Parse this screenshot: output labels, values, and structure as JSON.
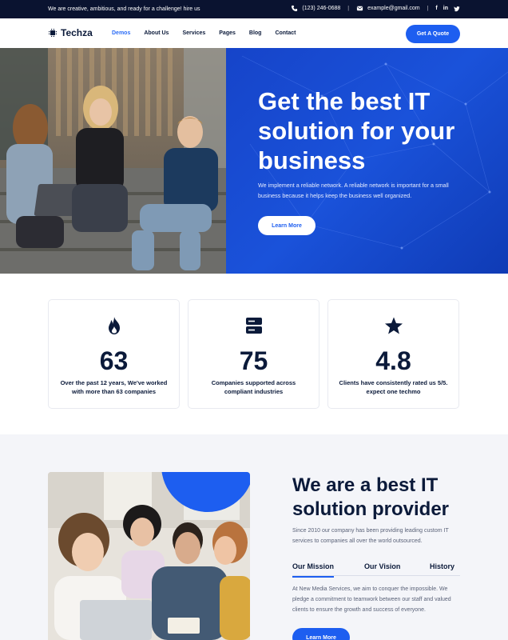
{
  "topbar": {
    "tagline": "We are creative, ambitious, and ready for a challenge! hire us",
    "phone": "(123) 246-0688",
    "email": "example@gmail.com",
    "social": [
      "f",
      "in",
      "t"
    ]
  },
  "nav": {
    "logo": "Techza",
    "items": [
      {
        "label": "Demos",
        "active": true
      },
      {
        "label": "About Us",
        "active": false
      },
      {
        "label": "Services",
        "active": false
      },
      {
        "label": "Pages",
        "active": false
      },
      {
        "label": "Blog",
        "active": false
      },
      {
        "label": "Contact",
        "active": false
      }
    ],
    "cta": "Get A Quote"
  },
  "hero": {
    "title": "Get the best IT solution for your business",
    "description": "We implement a reliable network. A reliable network is important for a small business because it helps keep the business well organized.",
    "button": "Learn More"
  },
  "stats": [
    {
      "icon": "fire-icon",
      "value": "63",
      "text": "Over the past 12 years, We've worked with more than 63 companies"
    },
    {
      "icon": "server-icon",
      "value": "75",
      "text": "Companies supported across compliant industries"
    },
    {
      "icon": "star-icon",
      "value": "4.8",
      "text": "Clients have consistently rated us 5/5. expect one techmo"
    }
  ],
  "about": {
    "title": "We are a best IT solution provider",
    "description": "Since 2010 our company has been providing leading custom IT services to companies all over the world outsourced.",
    "tabs": [
      {
        "label": "Our Mission",
        "active": true
      },
      {
        "label": "Our Vision",
        "active": false
      },
      {
        "label": "History",
        "active": false
      }
    ],
    "body": "At New Media Services, we aim to conquer the impossible. We pledge a commitment to teamwork between our staff and valued clients to ensure the growth and success of everyone.",
    "button": "Learn More"
  },
  "colors": {
    "accent": "#1d5ef0",
    "dark": "#0a1330",
    "hero_blue": "#1a52da"
  }
}
